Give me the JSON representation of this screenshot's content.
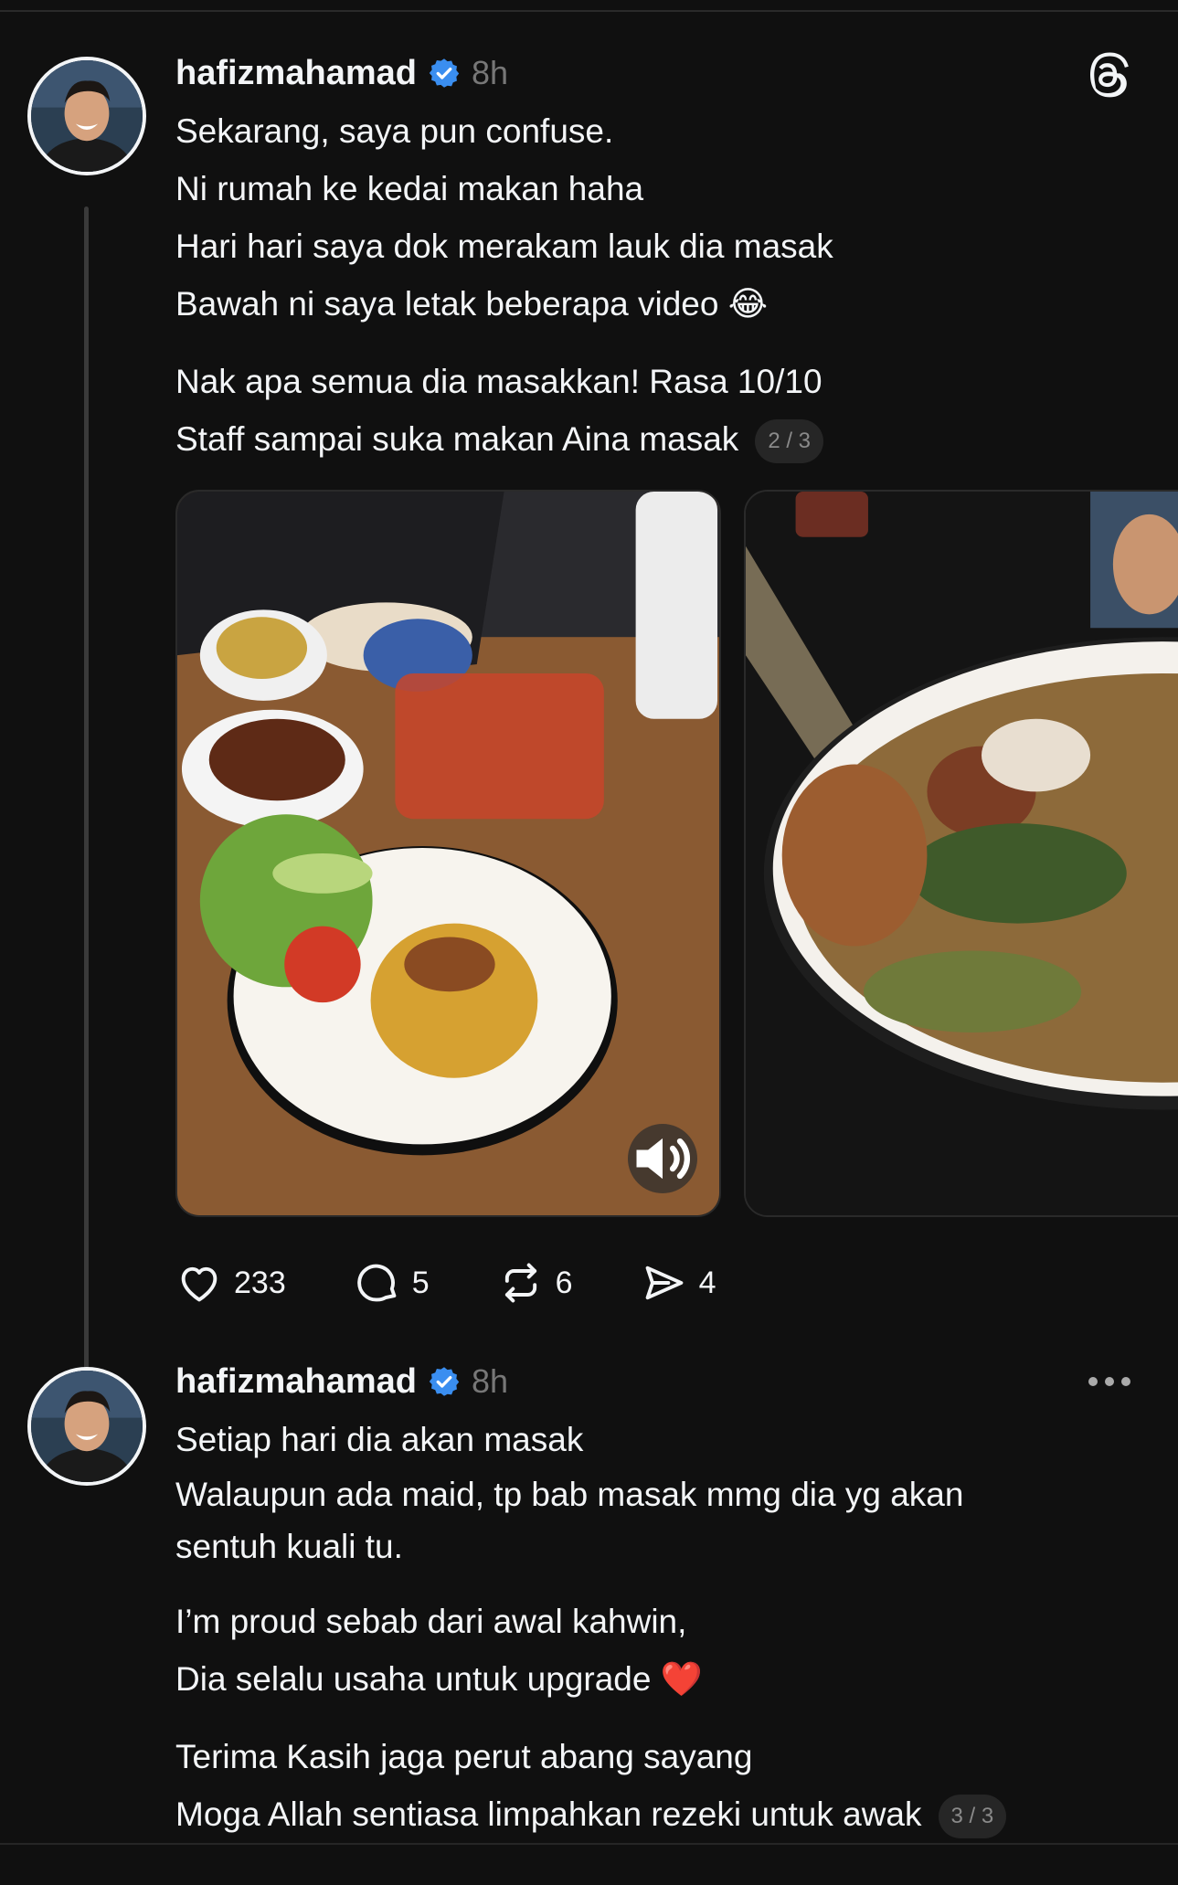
{
  "colors": {
    "background": "#101010",
    "text": "#f3f5f7",
    "muted": "#777777",
    "verified": "#3a8ef0",
    "heart": "#e0242c"
  },
  "post1": {
    "username": "hafizmahamad",
    "time": "8h",
    "avatar_icon": "avatar-photo",
    "paragraphs": [
      [
        "Sekarang, saya pun confuse.",
        "Ni rumah ke kedai makan haha",
        "Hari hari saya dok merakam lauk dia masak",
        "Bawah ni saya letak beberapa video 😂"
      ],
      [
        "Nak apa semua dia masakkan! Rasa 10/10",
        "Staff sampai suka makan Aina masak"
      ]
    ],
    "page": "2 / 3",
    "media": [
      {
        "kind": "video",
        "subject": "nasi goreng with fried chicken and sambal"
      },
      {
        "kind": "video",
        "subject": "bowl of vegetables and meat"
      }
    ],
    "stats": {
      "likes": "233",
      "replies": "5",
      "reposts": "6",
      "shares": "4"
    }
  },
  "post2": {
    "username": "hafizmahamad",
    "time": "8h",
    "paragraphs": [
      [
        "Setiap hari dia akan masak",
        "Walaupun ada maid, tp bab masak mmg dia yg akan sentuh kuali tu."
      ],
      [
        "I’m proud sebab dari awal kahwin,",
        "Dia selalu usaha untuk upgrade ❤️"
      ],
      [
        "Terima Kasih jaga perut abang sayang",
        "Moga Allah sentiasa limpahkan rezeki untuk awak"
      ]
    ],
    "page": "3 / 3"
  }
}
